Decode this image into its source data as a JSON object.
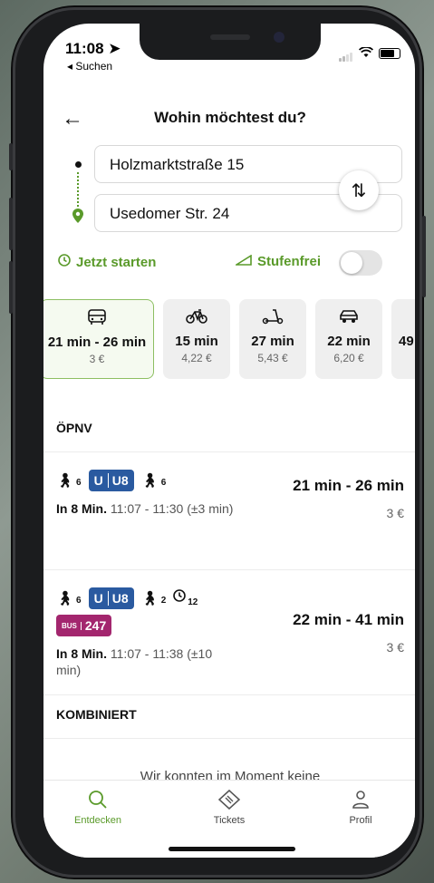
{
  "status": {
    "time": "11:08 ➤",
    "back_app": "◂ Suchen"
  },
  "header": {
    "title": "Wohin möchtest du?"
  },
  "route": {
    "from": "Holzmarktstraße 15",
    "to": "Usedomer Str. 24"
  },
  "options": {
    "now_label": "Jetzt starten",
    "stepfree_label": "Stufenfrei",
    "stepfree_on": false
  },
  "modes": [
    {
      "icon": "bus-icon",
      "duration": "21 min - 26 min",
      "price": "3 €",
      "active": true
    },
    {
      "icon": "bike-icon",
      "duration": "15 min",
      "price": "4,22 €"
    },
    {
      "icon": "scooter-icon",
      "duration": "27 min",
      "price": "5,43 €"
    },
    {
      "icon": "car-icon",
      "duration": "22 min",
      "price": "6,20 €"
    },
    {
      "icon": "more-icon",
      "duration": "49",
      "price": ""
    }
  ],
  "oepnv": {
    "title": "ÖPNV",
    "trips": [
      {
        "walk1": "6",
        "line_u": "U",
        "line": "U8",
        "walk2": "6",
        "depart_label": "In 8 Min.",
        "times": "11:07 - 11:30 (±3 min)",
        "duration": "21 min - 26 min",
        "price": "3 €"
      },
      {
        "walk1": "6",
        "line_u": "U",
        "line": "U8",
        "walk2": "2",
        "wait": "12",
        "bus_label": "BUS",
        "bus_line": "247",
        "depart_label": "In 8 Min.",
        "times": "11:07 - 11:38 (±10 min)",
        "duration": "22 min - 41 min",
        "price": "3 €"
      }
    ]
  },
  "kombiniert": {
    "title": "KOMBINIERT",
    "message": "Wir konnten im Moment keine"
  },
  "tabs": [
    {
      "label": "Entdecken",
      "icon": "search-icon",
      "active": true
    },
    {
      "label": "Tickets",
      "icon": "ticket-icon"
    },
    {
      "label": "Profil",
      "icon": "profile-icon"
    }
  ],
  "colors": {
    "accent": "#5a9a2a",
    "ubahn": "#2a5aa0",
    "bus": "#a3266e"
  }
}
